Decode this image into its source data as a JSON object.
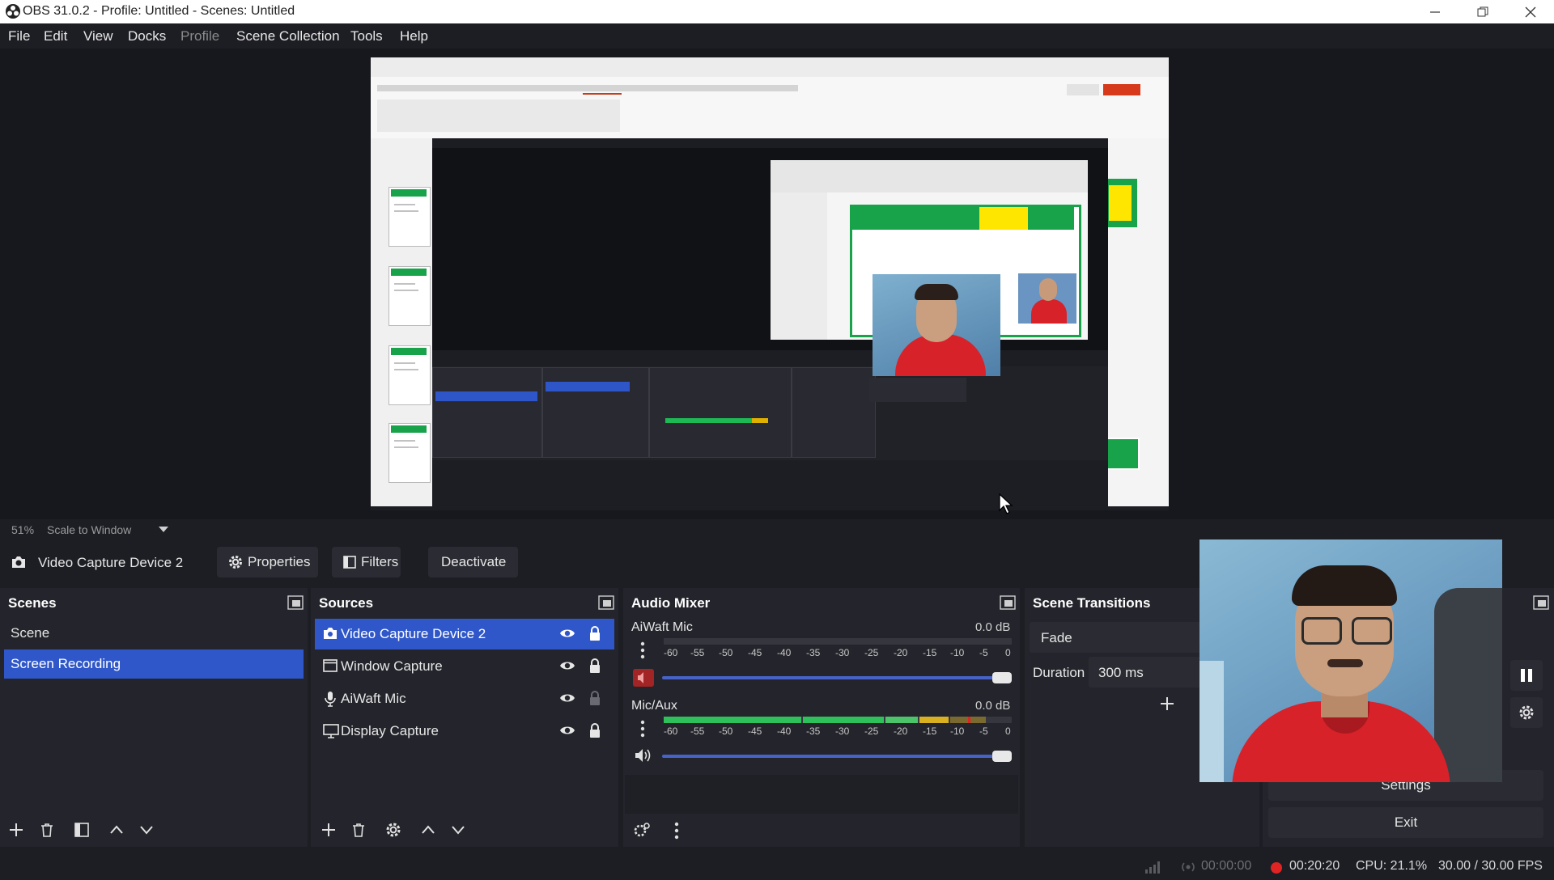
{
  "window": {
    "title": "OBS 31.0.2 - Profile: Untitled - Scenes: Untitled"
  },
  "menu": [
    {
      "label": "File",
      "disabled": false
    },
    {
      "label": "Edit",
      "disabled": false
    },
    {
      "label": "View",
      "disabled": false
    },
    {
      "label": "Docks",
      "disabled": false
    },
    {
      "label": "Profile",
      "disabled": true
    },
    {
      "label": "Scene Collection",
      "disabled": false
    },
    {
      "label": "Tools",
      "disabled": false
    },
    {
      "label": "Help",
      "disabled": false
    }
  ],
  "preview": {
    "zoom": "51%",
    "scale_mode": "Scale to Window"
  },
  "context_bar": {
    "source_name": "Video Capture Device 2",
    "properties_label": "Properties",
    "filters_label": "Filters",
    "deactivate_label": "Deactivate"
  },
  "scenes": {
    "title": "Scenes",
    "items": [
      {
        "label": "Scene",
        "selected": false
      },
      {
        "label": "Screen Recording",
        "selected": true
      }
    ]
  },
  "sources": {
    "title": "Sources",
    "items": [
      {
        "label": "Video Capture Device 2",
        "icon": "camera-icon",
        "visible": true,
        "locked": true,
        "selected": true
      },
      {
        "label": "Window Capture",
        "icon": "window-icon",
        "visible": true,
        "locked": true,
        "selected": false
      },
      {
        "label": "AiWaft Mic",
        "icon": "microphone-icon",
        "visible": true,
        "locked": false,
        "selected": false
      },
      {
        "label": "Display Capture",
        "icon": "monitor-icon",
        "visible": true,
        "locked": true,
        "selected": false
      }
    ]
  },
  "audio_mixer": {
    "title": "Audio Mixer",
    "scale_ticks": [
      "-60",
      "-55",
      "-50",
      "-45",
      "-40",
      "-35",
      "-30",
      "-25",
      "-20",
      "-15",
      "-10",
      "-5",
      "0"
    ],
    "channels": [
      {
        "name": "AiWaft Mic",
        "db": "0.0 dB",
        "muted": true,
        "level": 0.0,
        "volume": 1.0
      },
      {
        "name": "Mic/Aux",
        "db": "0.0 dB",
        "muted": false,
        "level": 0.9,
        "volume": 1.0
      }
    ]
  },
  "scene_transitions": {
    "title": "Scene Transitions",
    "transition": "Fade",
    "duration_label": "Duration",
    "duration_value": "300 ms"
  },
  "controls": {
    "settings_label": "Settings",
    "exit_label": "Exit"
  },
  "status": {
    "stream_time": "00:00:00",
    "record_time": "00:20:20",
    "cpu": "CPU: 21.1%",
    "fps": "30.00 / 30.00 FPS"
  },
  "colors": {
    "accent": "#2f57c9",
    "background": "#1d1e24",
    "dock": "#24252c",
    "recording": "#e02424"
  }
}
